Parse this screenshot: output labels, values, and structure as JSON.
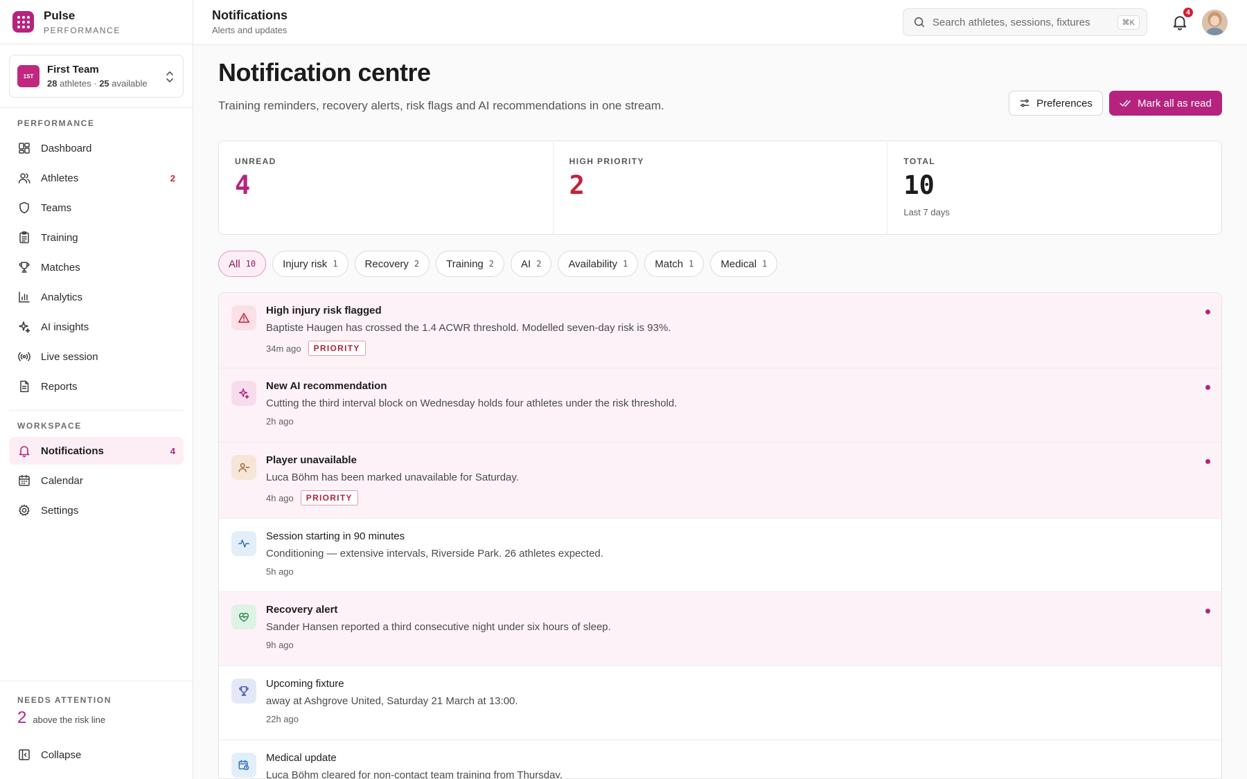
{
  "brand": {
    "name": "Pulse",
    "sub": "PERFORMANCE"
  },
  "team": {
    "badge": "1ST",
    "name": "First Team",
    "athletes": "28",
    "athletes_label": "athletes ·",
    "available": "25",
    "available_label": "available"
  },
  "nav": {
    "performance_label": "PERFORMANCE",
    "performance_items": [
      {
        "label": "Dashboard",
        "icon": "dashboard-icon",
        "count": ""
      },
      {
        "label": "Athletes",
        "icon": "athletes-icon",
        "count": "2"
      },
      {
        "label": "Teams",
        "icon": "shield-icon",
        "count": ""
      },
      {
        "label": "Training",
        "icon": "clipboard-icon",
        "count": ""
      },
      {
        "label": "Matches",
        "icon": "trophy-icon",
        "count": ""
      },
      {
        "label": "Analytics",
        "icon": "bar-chart-icon",
        "count": ""
      },
      {
        "label": "AI insights",
        "icon": "sparkle-icon",
        "count": ""
      },
      {
        "label": "Live session",
        "icon": "broadcast-icon",
        "count": ""
      },
      {
        "label": "Reports",
        "icon": "report-icon",
        "count": ""
      }
    ],
    "workspace_label": "WORKSPACE",
    "workspace_items": [
      {
        "label": "Notifications",
        "icon": "bell-icon",
        "count": "4"
      },
      {
        "label": "Calendar",
        "icon": "calendar-icon",
        "count": ""
      },
      {
        "label": "Settings",
        "icon": "gear-icon",
        "count": ""
      }
    ]
  },
  "attention": {
    "label": "NEEDS ATTENTION",
    "count": "2",
    "text": "above the risk line"
  },
  "collapse_label": "Collapse",
  "topbar": {
    "title": "Notifications",
    "subtitle": "Alerts and updates",
    "search_placeholder": "Search athletes, sessions, fixtures",
    "shortcut": "⌘K",
    "bell_count": "4"
  },
  "page": {
    "title": "Notification centre",
    "subtitle": "Training reminders, recovery alerts, risk flags and AI recommendations in one stream.",
    "preferences_label": "Preferences",
    "mark_all_label": "Mark all as read"
  },
  "stats": [
    {
      "label": "UNREAD",
      "value": "4",
      "note": "",
      "color": "#b5237f"
    },
    {
      "label": "HIGH PRIORITY",
      "value": "2",
      "note": "",
      "color": "#c0243a"
    },
    {
      "label": "TOTAL",
      "value": "10",
      "note": "Last 7 days",
      "color": "#1c1c1c"
    }
  ],
  "filters": [
    {
      "label": "All",
      "count": "10",
      "active": true
    },
    {
      "label": "Injury risk",
      "count": "1",
      "active": false
    },
    {
      "label": "Recovery",
      "count": "2",
      "active": false
    },
    {
      "label": "Training",
      "count": "2",
      "active": false
    },
    {
      "label": "AI",
      "count": "2",
      "active": false
    },
    {
      "label": "Availability",
      "count": "1",
      "active": false
    },
    {
      "label": "Match",
      "count": "1",
      "active": false
    },
    {
      "label": "Medical",
      "count": "1",
      "active": false
    }
  ],
  "notifications": [
    {
      "title": "High injury risk flagged",
      "body": "Baptiste Haugen has crossed the 1.4 ACWR threshold. Modelled seven-day risk is 93%.",
      "time": "34m ago",
      "priority": "PRIORITY",
      "unread": true,
      "icon": "warning-icon",
      "icon_bg": "#fbe1e6",
      "icon_color": "#c0243a"
    },
    {
      "title": "New AI recommendation",
      "body": "Cutting the third interval block on Wednesday holds four athletes under the risk threshold.",
      "time": "2h ago",
      "priority": "",
      "unread": true,
      "icon": "sparkle-icon",
      "icon_bg": "#f7dcec",
      "icon_color": "#b5237f"
    },
    {
      "title": "Player unavailable",
      "body": "Luca Böhm has been marked unavailable for Saturday.",
      "time": "4h ago",
      "priority": "PRIORITY",
      "unread": true,
      "icon": "user-minus-icon",
      "icon_bg": "#f5e6d8",
      "icon_color": "#a0622c"
    },
    {
      "title": "Session starting in 90 minutes",
      "body": "Conditioning — extensive intervals, Riverside Park. 26 athletes expected.",
      "time": "5h ago",
      "priority": "",
      "unread": false,
      "icon": "activity-icon",
      "icon_bg": "#e2eef8",
      "icon_color": "#2f74b5"
    },
    {
      "title": "Recovery alert",
      "body": "Sander Hansen reported a third consecutive night under six hours of sleep.",
      "time": "9h ago",
      "priority": "",
      "unread": true,
      "icon": "heart-pulse-icon",
      "icon_bg": "#dff2e6",
      "icon_color": "#2c8a4c"
    },
    {
      "title": "Upcoming fixture",
      "body": "away at Ashgrove United, Saturday 21 March at 13:00.",
      "time": "22h ago",
      "priority": "",
      "unread": false,
      "icon": "trophy-icon",
      "icon_bg": "#e4e8f6",
      "icon_color": "#4656a8"
    },
    {
      "title": "Medical update",
      "body": "Luca Böhm cleared for non-contact team training from Thursday.",
      "time": "",
      "priority": "",
      "unread": false,
      "icon": "calendar-clock-icon",
      "icon_bg": "#e2eef8",
      "icon_color": "#2f74b5"
    }
  ]
}
